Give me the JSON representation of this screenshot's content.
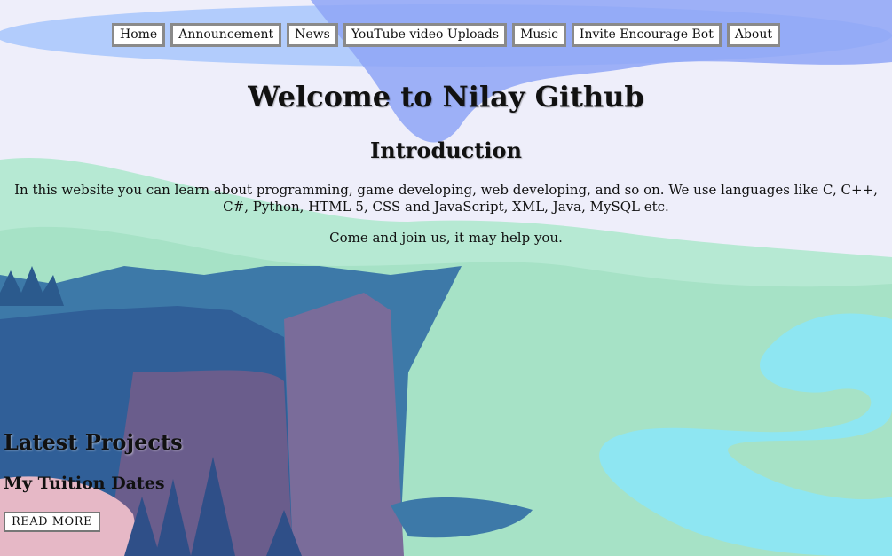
{
  "nav": {
    "items": [
      "Home",
      "Announcement",
      "News",
      "YouTube video Uploads",
      "Music",
      "Invite Encourage Bot",
      "About"
    ]
  },
  "main": {
    "title": "Welcome to Nilay Github",
    "subtitle": "Introduction",
    "intro_text": "In this website you can learn about programming, game developing, web developing, and so on. We use languages like C, C++, C#, Python, HTML 5, CSS and JavaScript, XML, Java, MySQL etc.",
    "join_text": "Come and join us, it may help you."
  },
  "projects": {
    "heading": "Latest Projects",
    "item_title": "My Tuition Dates",
    "read_more": "READ MORE"
  },
  "colors": {
    "sky": "#eeeefa",
    "cloud_blue": "#8fb0f8",
    "hill_green": "#a8e4c8",
    "cliff_purple": "#6e6490",
    "river": "#8ee6f2"
  }
}
